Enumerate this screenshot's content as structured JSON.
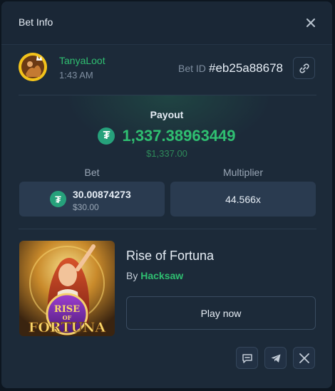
{
  "header": {
    "title": "Bet Info"
  },
  "user": {
    "name": "TanyaLoot",
    "time": "1:43 AM"
  },
  "bet_id": {
    "label": "Bet ID",
    "value": "#eb25a88678"
  },
  "payout": {
    "label": "Payout",
    "amount": "1,337.38963449",
    "usd": "$1,337.00"
  },
  "bet": {
    "label": "Bet",
    "amount": "30.00874273",
    "usd": "$30.00"
  },
  "multiplier": {
    "label": "Multiplier",
    "value": "44.566x"
  },
  "game": {
    "title": "Rise of Fortuna",
    "provider_prefix": "By",
    "provider": "Hacksaw",
    "thumbnail_text_top": "RISE",
    "thumbnail_text_mid": "OF",
    "thumbnail_text_bottom": "FORTUNA"
  },
  "play_button": "Play now",
  "currency_icon": "tether-icon",
  "colors": {
    "accent_green": "#2fbf71",
    "panel_bg": "#1c2a39",
    "card_bg": "#2a3b50",
    "tether": "#26a17b"
  }
}
